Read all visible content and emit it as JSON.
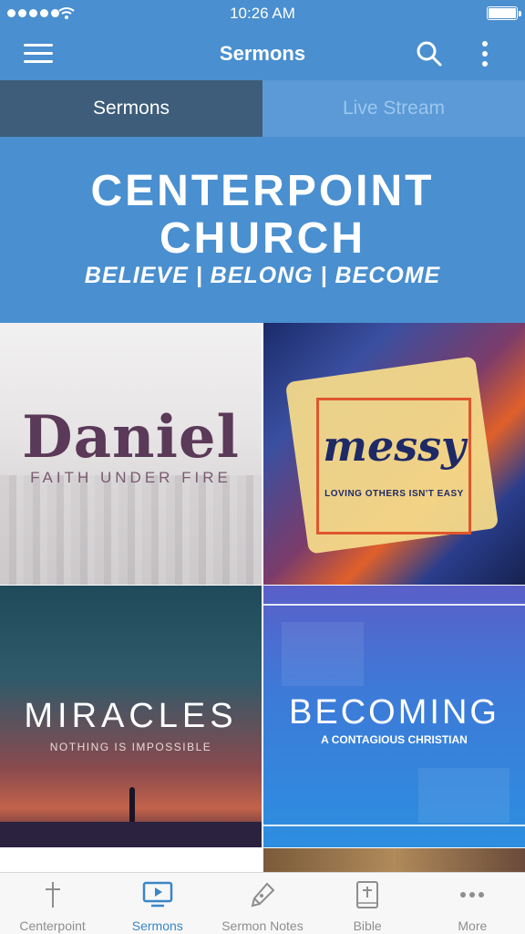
{
  "status_bar": {
    "time": "10:26 AM"
  },
  "nav": {
    "title": "Sermons",
    "menu_icon": "hamburger-icon",
    "search_icon": "search-icon",
    "more_icon": "vertical-ellipsis-icon"
  },
  "tabs": [
    {
      "label": "Sermons",
      "active": true
    },
    {
      "label": "Live Stream",
      "active": false
    }
  ],
  "banner": {
    "line1": "CENTERPOINT",
    "line2": "CHURCH",
    "tagline": "BELIEVE | BELONG | BECOME"
  },
  "sermons": [
    {
      "title": "Daniel",
      "subtitle": "FAITH UNDER FIRE"
    },
    {
      "title": "messy",
      "subtitle": "LOVING OTHERS ISN'T EASY"
    },
    {
      "title": "MIRACLES",
      "subtitle": "NOTHING IS IMPOSSIBLE"
    },
    {
      "title": "BECOMING",
      "subtitle": "A CONTAGIOUS CHRISTIAN"
    }
  ],
  "tabbar": [
    {
      "label": "Centerpoint",
      "icon": "cross-icon",
      "active": false
    },
    {
      "label": "Sermons",
      "icon": "tv-play-icon",
      "active": true
    },
    {
      "label": "Sermon Notes",
      "icon": "pen-icon",
      "active": false
    },
    {
      "label": "Bible",
      "icon": "bible-icon",
      "active": false
    },
    {
      "label": "More",
      "icon": "ellipsis-icon",
      "active": false
    }
  ],
  "colors": {
    "accent": "#4a8fcf",
    "tab_active_bg": "#3d5d7a",
    "tabbar_active": "#3a86c8"
  }
}
